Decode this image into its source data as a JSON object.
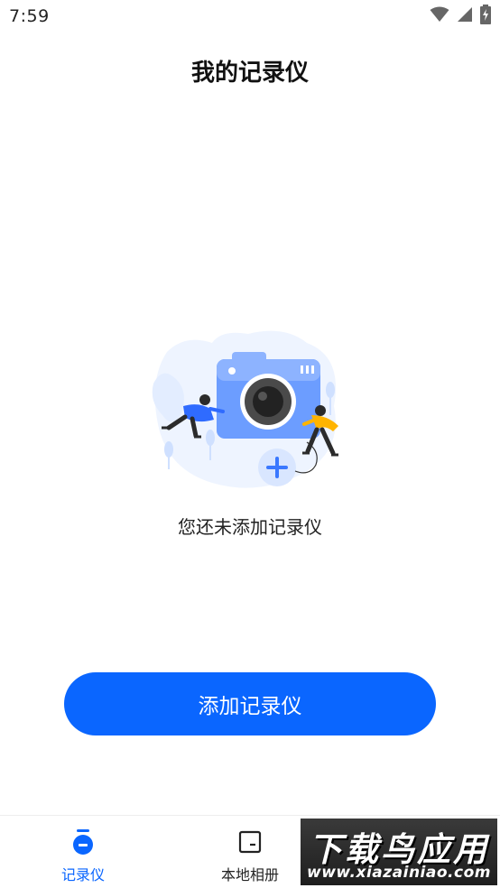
{
  "status_bar": {
    "time": "7:59",
    "icons": [
      "wifi-icon",
      "cellular-signal-icon",
      "battery-charging-icon"
    ]
  },
  "header": {
    "title": "我的记录仪"
  },
  "empty_state": {
    "illustration": "camera-add-illustration",
    "message": "您还未添加记录仪"
  },
  "actions": {
    "add_button_label": "添加记录仪"
  },
  "bottom_nav": {
    "items": [
      {
        "label": "记录仪",
        "icon": "recorder-icon",
        "active": true
      },
      {
        "label": "本地相册",
        "icon": "album-icon",
        "active": false
      }
    ]
  },
  "watermark": {
    "title": "下载鸟应用",
    "url": "www.xiazainiao.com"
  },
  "colors": {
    "accent": "#0a66ff",
    "text": "#222222",
    "background": "#ffffff"
  }
}
